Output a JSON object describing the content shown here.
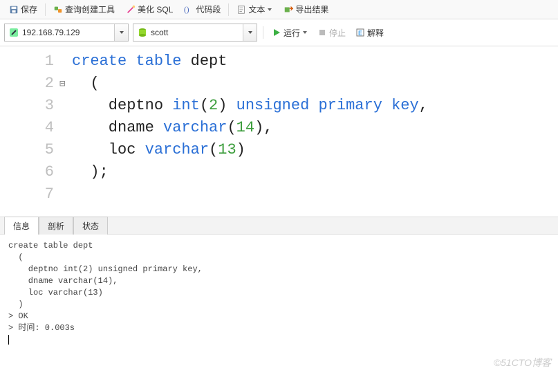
{
  "toolbar": {
    "save": "保存",
    "query_builder": "查询创建工具",
    "beautify_sql": "美化 SQL",
    "snippet": "代码段",
    "text": "文本",
    "export": "导出结果"
  },
  "connection": {
    "host": "192.168.79.129",
    "database": "scott"
  },
  "actions": {
    "run": "运行",
    "stop": "停止",
    "explain": "解释"
  },
  "editor": {
    "lines": [
      "1",
      "2",
      "3",
      "4",
      "5",
      "6",
      "7"
    ],
    "fold_marker": "⊟"
  },
  "code": {
    "l1_kw1": "create",
    "l1_kw2": "table",
    "l1_ident": " dept",
    "l2": "  (",
    "l3_name": "    deptno ",
    "l3_type": "int",
    "l3_paren_open": "(",
    "l3_num": "2",
    "l3_paren_close": ") ",
    "l3_rest": "unsigned primary key",
    "l3_tail": ",",
    "l4_name": "    dname ",
    "l4_type": "varchar",
    "l4_paren_open": "(",
    "l4_num": "14",
    "l4_paren_close": "),",
    "l5_name": "    loc ",
    "l5_type": "varchar",
    "l5_paren_open": "(",
    "l5_num": "13",
    "l5_paren_close": ")",
    "l6": "  );"
  },
  "panel": {
    "tab_info": "信息",
    "tab_profile": "剖析",
    "tab_status": "状态"
  },
  "output": {
    "text": "create table dept\n  (\n    deptno int(2) unsigned primary key,\n    dname varchar(14),\n    loc varchar(13)\n  )\n> OK\n> 时间: 0.003s"
  },
  "watermark": "©51CTO博客"
}
